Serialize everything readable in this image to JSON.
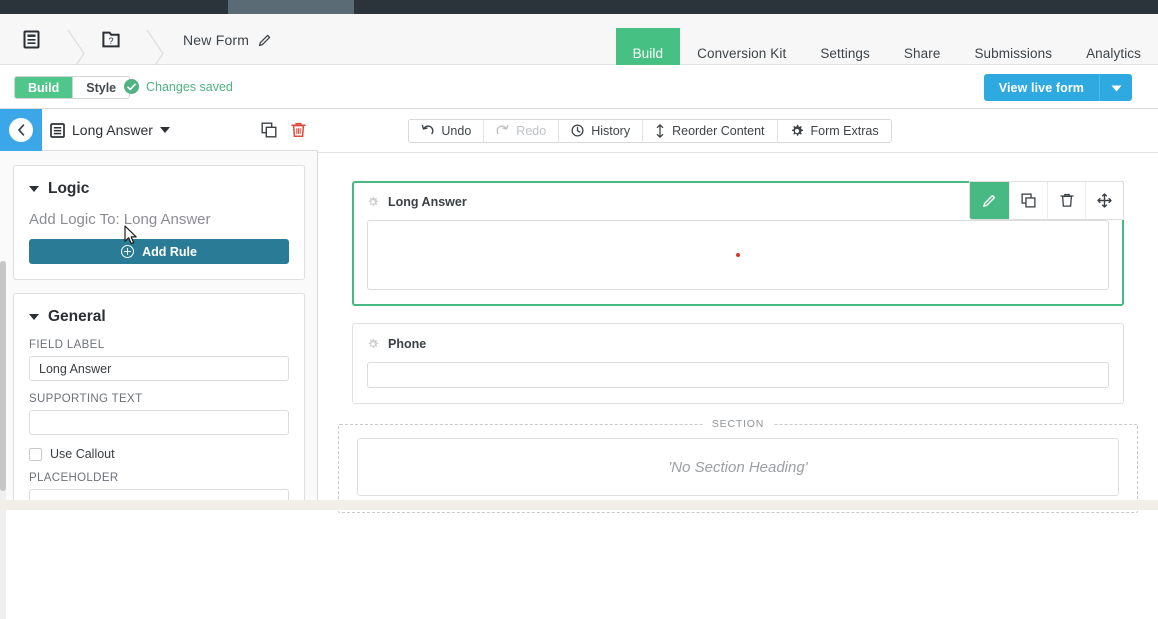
{
  "topbar": {
    "segment_label": ""
  },
  "breadcrumb": {
    "home_icon": "form-list-icon",
    "folder_icon": "folder-question-icon",
    "form_title": "New Form",
    "edit_icon": "pencil-icon"
  },
  "nav": {
    "tabs": [
      {
        "label": "Build",
        "active": true
      },
      {
        "label": "Conversion Kit",
        "active": false
      },
      {
        "label": "Settings",
        "active": false
      },
      {
        "label": "Share",
        "active": false
      },
      {
        "label": "Submissions",
        "active": false
      },
      {
        "label": "Analytics",
        "active": false
      }
    ]
  },
  "subbar": {
    "mode_build": "Build",
    "mode_style": "Style",
    "saved_text": "Changes saved",
    "saved_icon": "check-circle-icon",
    "live_button": "View live form",
    "live_caret_icon": "caret-down-icon"
  },
  "left_panel": {
    "back_icon": "chevron-left-icon",
    "field_type_icon": "long-answer-icon",
    "field_type": "Long Answer",
    "dropdown_icon": "caret-down-icon",
    "duplicate_icon": "duplicate-icon",
    "delete_icon": "trash-icon",
    "logic": {
      "title": "Logic",
      "collapse_icon": "caret-down-icon",
      "subtitle": "Add Logic To: Long Answer",
      "add_rule_label": "Add Rule",
      "add_rule_icon": "plus-circle-icon",
      "add_rule_color": "#2a7c96"
    },
    "general": {
      "title": "General",
      "collapse_icon": "caret-down-icon",
      "field_label_caption": "FIELD LABEL",
      "field_label_value": "Long Answer",
      "supporting_text_caption": "SUPPORTING TEXT",
      "supporting_text_value": "",
      "use_callout_label": "Use Callout",
      "use_callout_checked": false,
      "placeholder_caption": "PLACEHOLDER",
      "placeholder_value": ""
    }
  },
  "canvas_toolbar": {
    "buttons": [
      {
        "label": "Undo",
        "icon": "undo-icon",
        "disabled": false
      },
      {
        "label": "Redo",
        "icon": "redo-icon",
        "disabled": true
      },
      {
        "label": "History",
        "icon": "clock-icon",
        "disabled": false
      },
      {
        "label": "Reorder Content",
        "icon": "updown-arrow-icon",
        "disabled": false
      },
      {
        "label": "Form Extras",
        "icon": "gear-icon",
        "disabled": false
      }
    ]
  },
  "form": {
    "fields": [
      {
        "name": "Long Answer",
        "type": "textarea",
        "selected": true,
        "gear_icon": "gear-icon",
        "tools": [
          {
            "icon": "pencil-icon",
            "accent": true
          },
          {
            "icon": "duplicate-icon",
            "accent": false
          },
          {
            "icon": "trash-icon",
            "accent": false
          },
          {
            "icon": "move-icon",
            "accent": false
          }
        ]
      },
      {
        "name": "Phone",
        "type": "text",
        "selected": false,
        "gear_icon": "gear-icon",
        "tools": []
      }
    ],
    "section": {
      "tag": "SECTION",
      "heading_placeholder": "'No Section Heading'"
    }
  },
  "colors": {
    "accent_green": "#47c183",
    "accent_blue": "#2eaae0",
    "back_blue": "#3ba7e8",
    "teal_button": "#2a7c96",
    "dark_bar": "#2b343b",
    "red_dot": "#d9372b"
  },
  "cursor": {
    "icon": "arrow-cursor"
  }
}
